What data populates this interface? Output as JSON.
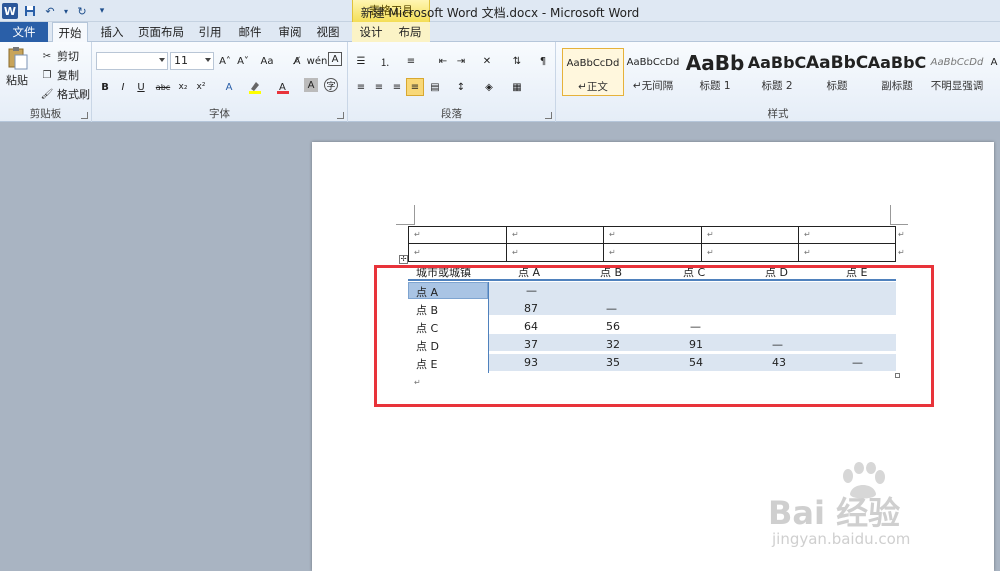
{
  "window": {
    "title": "新建 Microsoft Word 文档.docx - Microsoft Word",
    "context_group": "表格工具"
  },
  "tabs": [
    {
      "id": "file",
      "label": "文件"
    },
    {
      "id": "home",
      "label": "开始"
    },
    {
      "id": "insert",
      "label": "插入"
    },
    {
      "id": "layout",
      "label": "页面布局"
    },
    {
      "id": "references",
      "label": "引用"
    },
    {
      "id": "mailings",
      "label": "邮件"
    },
    {
      "id": "review",
      "label": "审阅"
    },
    {
      "id": "view",
      "label": "视图"
    },
    {
      "id": "design",
      "label": "设计"
    },
    {
      "id": "table_layout",
      "label": "布局"
    }
  ],
  "clipboard": {
    "paste": "粘贴",
    "cut": "剪切",
    "copy": "复制",
    "format_painter": "格式刷",
    "label": "剪贴板"
  },
  "font": {
    "name_value": "",
    "size_value": "11",
    "label": "字体"
  },
  "paragraph": {
    "label": "段落"
  },
  "styles": {
    "label": "样式",
    "items": [
      {
        "sample": "AaBbCcDd",
        "name": "↵正文"
      },
      {
        "sample": "AaBbCcDd",
        "name": "↵无间隔"
      },
      {
        "sample": "AaBb",
        "name": "标题 1"
      },
      {
        "sample": "AaBbC",
        "name": "标题 2"
      },
      {
        "sample": "AaBbC",
        "name": "标题"
      },
      {
        "sample": "AaBbC",
        "name": "副标题"
      },
      {
        "sample": "AaBbCcDd",
        "name": "不明显强调"
      },
      {
        "sample": "A",
        "name": ""
      }
    ]
  },
  "document": {
    "paragraph_mark": "↵",
    "table_header": [
      "城市或城镇",
      "点  A",
      "点  B",
      "点  C",
      "点  D",
      "点  E"
    ],
    "table_rows": [
      {
        "label": "点  A",
        "values": [
          "—",
          "",
          "",
          "",
          ""
        ]
      },
      {
        "label": "点  B",
        "values": [
          "87",
          "—",
          "",
          "",
          ""
        ]
      },
      {
        "label": "点  C",
        "values": [
          "64",
          "56",
          "—",
          "",
          ""
        ]
      },
      {
        "label": "点  D",
        "values": [
          "37",
          "32",
          "91",
          "—",
          ""
        ]
      },
      {
        "label": "点  E",
        "values": [
          "93",
          "35",
          "54",
          "43",
          "—"
        ]
      }
    ]
  },
  "watermark": {
    "brand": "Bai 经验",
    "url": "jingyan.baidu.com"
  },
  "colors": {
    "accent_red": "#e8333a",
    "table_blue_band": "#dbe5f1",
    "table_header_line": "#4f81bd",
    "file_tab": "#2a5fa8"
  }
}
